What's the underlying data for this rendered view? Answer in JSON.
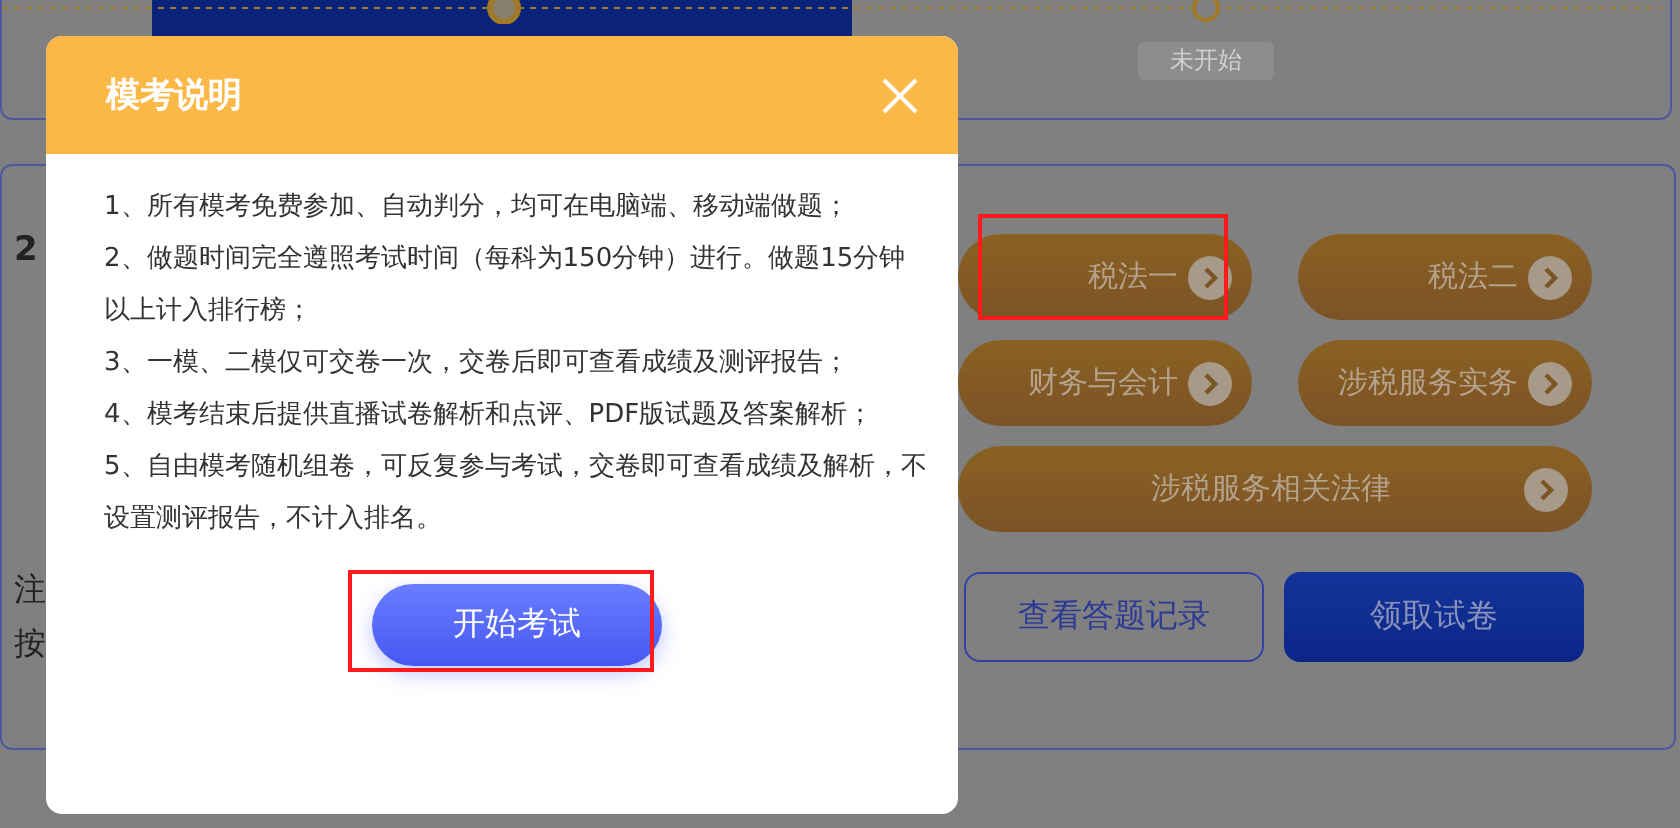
{
  "progress": {
    "badge": "未开始"
  },
  "panel": {
    "heading_fragment": "2",
    "note_fragments": [
      "注",
      "按"
    ],
    "subjects": [
      {
        "label": "税法一",
        "kind": "half",
        "highlighted": true
      },
      {
        "label": "税法二",
        "kind": "half",
        "highlighted": false
      },
      {
        "label": "财务与会计",
        "kind": "half",
        "highlighted": false
      },
      {
        "label": "涉税服务实务",
        "kind": "half",
        "highlighted": false
      },
      {
        "label": "涉税服务相关法律",
        "kind": "wide",
        "highlighted": false
      }
    ],
    "actions": [
      {
        "label": "查看答题记录",
        "kind": "outline"
      },
      {
        "label": "领取试卷",
        "kind": "filled"
      }
    ]
  },
  "dialog": {
    "title": "模考说明",
    "items": [
      "1、所有模考免费参加、自动判分，均可在电脑端、移动端做题；",
      "2、做题时间完全遵照考试时间（每科为150分钟）进行。做题15分钟以上计入排行榜；",
      "3、一模、二模仅可交卷一次，交卷后即可查看成绩及测评报告；",
      "4、模考结束后提供直播试卷解析和点评、PDF版试题及答案解析；",
      "5、自由模考随机组卷，可反复参与考试，交卷即可查看成绩及解析，不设置测评报告，不计入排名。"
    ],
    "start_button": {
      "label": "开始考试",
      "highlighted": true
    }
  }
}
